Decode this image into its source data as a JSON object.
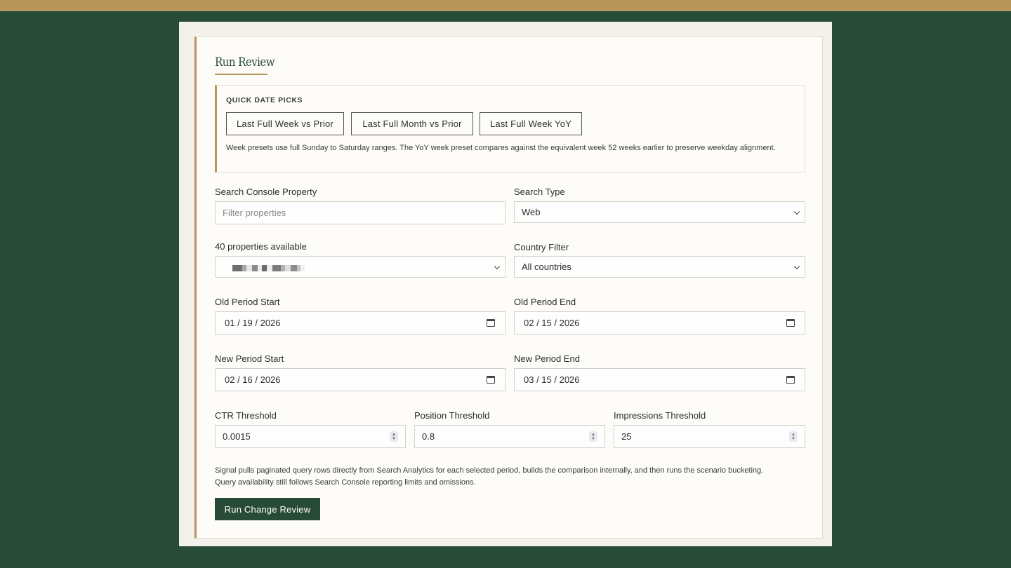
{
  "colors": {
    "brand_green": "#284b38",
    "accent_gold": "#b8955a",
    "card_bg": "#fdfcf8"
  },
  "review": {
    "title": "Run Review"
  },
  "quick_picks": {
    "label": "QUICK DATE PICKS",
    "buttons": [
      "Last Full Week vs Prior",
      "Last Full Month vs Prior",
      "Last Full Week YoY"
    ],
    "note": "Week presets use full Sunday to Saturday ranges. The YoY week preset compares against the equivalent week 52 weeks earlier to preserve weekday alignment."
  },
  "property": {
    "label": "Search Console Property",
    "placeholder": "Filter properties",
    "count_label": "40 properties available",
    "selected_value_obscured": true
  },
  "search_type": {
    "label": "Search Type",
    "value": "Web"
  },
  "country": {
    "label": "Country Filter",
    "value": "All countries"
  },
  "old_period": {
    "start_label": "Old Period Start",
    "start_value": "01 / 19 / 2026",
    "end_label": "Old Period End",
    "end_value": "02 / 15 / 2026"
  },
  "new_period": {
    "start_label": "New Period Start",
    "start_value": "02 / 16 / 2026",
    "end_label": "New Period End",
    "end_value": "03 / 15 / 2026"
  },
  "thresholds": {
    "ctr_label": "CTR Threshold",
    "ctr_value": "0.0015",
    "position_label": "Position Threshold",
    "position_value": "0.8",
    "impressions_label": "Impressions Threshold",
    "impressions_value": "25"
  },
  "footer_note": {
    "line1": "Signal pulls paginated query rows directly from Search Analytics for each selected period, builds the comparison internally, and then runs the scenario bucketing.",
    "line2": "Query availability still follows Search Console reporting limits and omissions."
  },
  "actions": {
    "run_label": "Run Change Review"
  },
  "icons": {
    "select_arrow": "chevron-down-icon",
    "date_picker": "calendar-icon",
    "number_stepper": "stepper-icon"
  }
}
